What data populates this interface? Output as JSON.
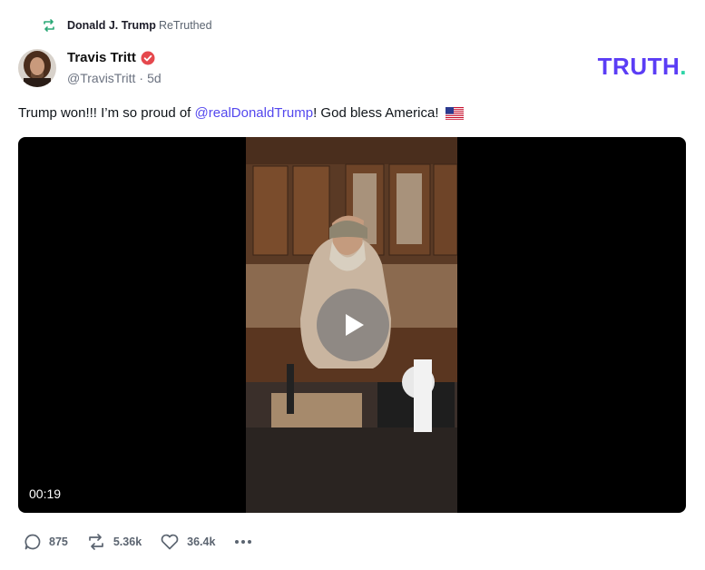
{
  "retruth": {
    "icon": "retruth-icon",
    "by": "Donald J. Trump",
    "action": "ReTruthed"
  },
  "author": {
    "name": "Travis Tritt",
    "handle": "@TravisTritt",
    "separator": "·",
    "time": "5d",
    "verified_icon": "verified-badge-icon"
  },
  "brand": {
    "logo_text": "TRUTH",
    "logo_dot": ".",
    "primary_color": "#5b3df5",
    "dot_color": "#2ed4a7"
  },
  "post": {
    "text_before": "Trump won!!! I’m so proud of ",
    "mention": "@realDonaldTrump",
    "text_after": "! God bless America!",
    "emoji_icon": "us-flag-icon"
  },
  "video": {
    "duration": "00:19",
    "play_icon": "play-icon"
  },
  "actions": {
    "replies": "875",
    "retruths": "5.36k",
    "likes": "36.4k",
    "reply_icon": "comment-icon",
    "retruth_icon": "retruth-icon",
    "like_icon": "heart-icon",
    "more_icon": "more-icon"
  }
}
